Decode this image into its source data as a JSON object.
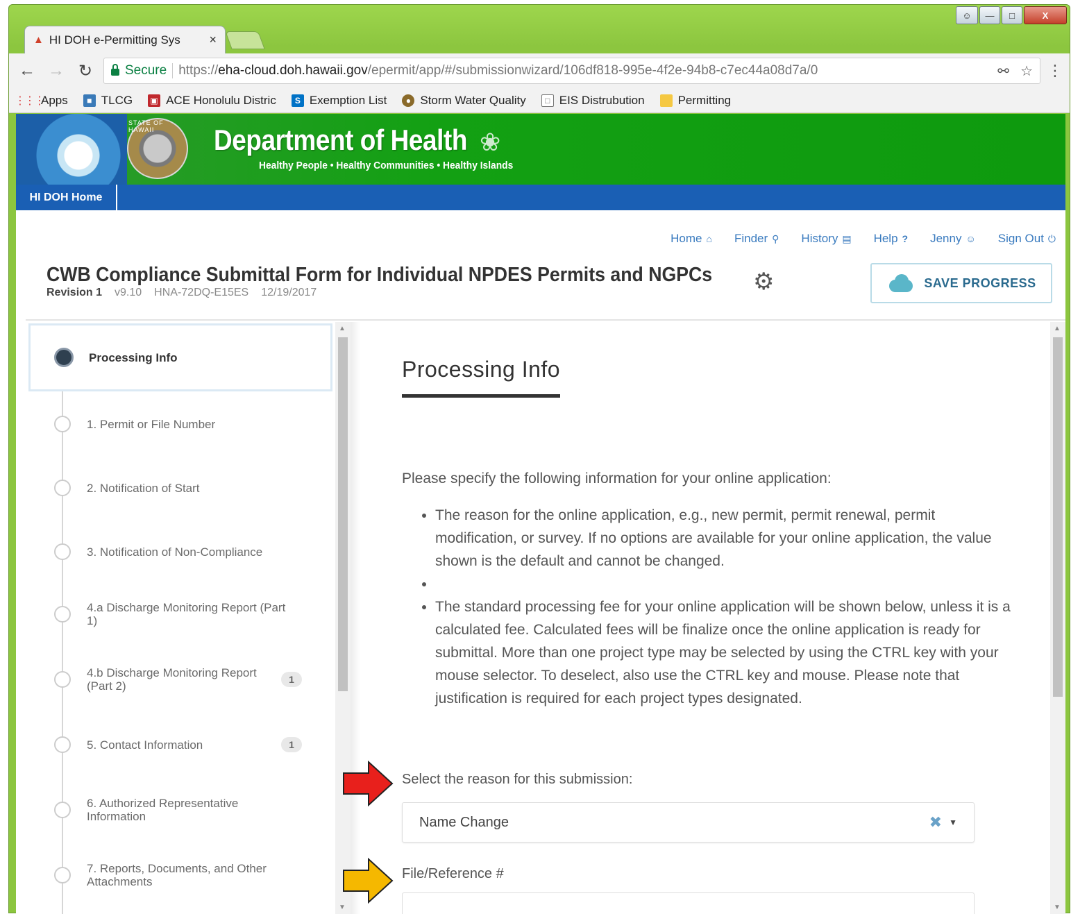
{
  "browser": {
    "tab_title": "HI DOH e-Permitting Sys",
    "tab_close": "×",
    "secure_label": "Secure",
    "url_scheme": "https://",
    "url_host": "eha-cloud.doh.hawaii.gov",
    "url_path": "/epermit/app/#/submissionwizard/106df818-995e-4f2e-94b8-c7ec44a08d7a/0",
    "bookmarks": [
      {
        "label": "Apps",
        "icon": "apps-icon"
      },
      {
        "label": "TLCG",
        "icon": "tlcg-icon"
      },
      {
        "label": "ACE Honolulu Distric",
        "icon": "ace-icon"
      },
      {
        "label": "Exemption List",
        "icon": "sharepoint-icon"
      },
      {
        "label": "Storm Water Quality",
        "icon": "storm-water-icon"
      },
      {
        "label": "EIS Distrubution",
        "icon": "document-icon"
      },
      {
        "label": "Permitting",
        "icon": "folder-icon"
      }
    ]
  },
  "banner": {
    "title": "Department of Health",
    "slogan": "Healthy People • Healthy Communities • Healthy Islands",
    "seal_text": "STATE OF HAWAII",
    "home_link": "HI DOH Home"
  },
  "topnav": {
    "home": "Home",
    "finder": "Finder",
    "history": "History",
    "help": "Help",
    "user": "Jenny",
    "signout": "Sign Out"
  },
  "form": {
    "title": "CWB Compliance Submittal Form for Individual NPDES Permits and NGPCs",
    "revision": "Revision 1",
    "version": "v9.10",
    "code": "HNA-72DQ-E15ES",
    "date": "12/19/2017",
    "save_label": "SAVE PROGRESS"
  },
  "sidebar": {
    "steps": [
      {
        "label": "Processing Info",
        "badge": ""
      },
      {
        "label": "1. Permit or File Number",
        "badge": ""
      },
      {
        "label": "2. Notification of Start",
        "badge": ""
      },
      {
        "label": "3. Notification of Non-Compliance",
        "badge": ""
      },
      {
        "label": "4.a Discharge Monitoring Report (Part 1)",
        "badge": ""
      },
      {
        "label": "4.b Discharge Monitoring Report (Part 2)",
        "badge": "1"
      },
      {
        "label": "5. Contact Information",
        "badge": "1"
      },
      {
        "label": "6. Authorized Representative Information",
        "badge": ""
      },
      {
        "label": "7. Reports, Documents, and Other Attachments",
        "badge": ""
      }
    ]
  },
  "main": {
    "section_title": "Processing Info",
    "intro": "Please specify the following information for your online application:",
    "bullets": [
      "The reason for the online application, e.g., new permit, permit renewal, permit modification, or survey. If no options are available for your online application, the value shown is the default and cannot be changed.",
      "",
      "The standard processing fee for your online application will be shown below, unless it is a calculated fee. Calculated fees will be finalize once the online application is ready for submittal. More than one project type may be selected by using the CTRL key with your mouse selector. To deselect, also use the CTRL key and mouse. Please note that justification is required for each project types designated."
    ],
    "reason_label": "Select the reason for this submission:",
    "reason_value": "Name Change",
    "file_ref_label": "File/Reference #",
    "file_ref_value": ""
  },
  "colors": {
    "annotation_red": "#e8201c",
    "annotation_yellow": "#f5b800",
    "link_blue": "#3a7bbf",
    "banner_green": "#13a013",
    "nav_blue": "#1a5fb4"
  }
}
